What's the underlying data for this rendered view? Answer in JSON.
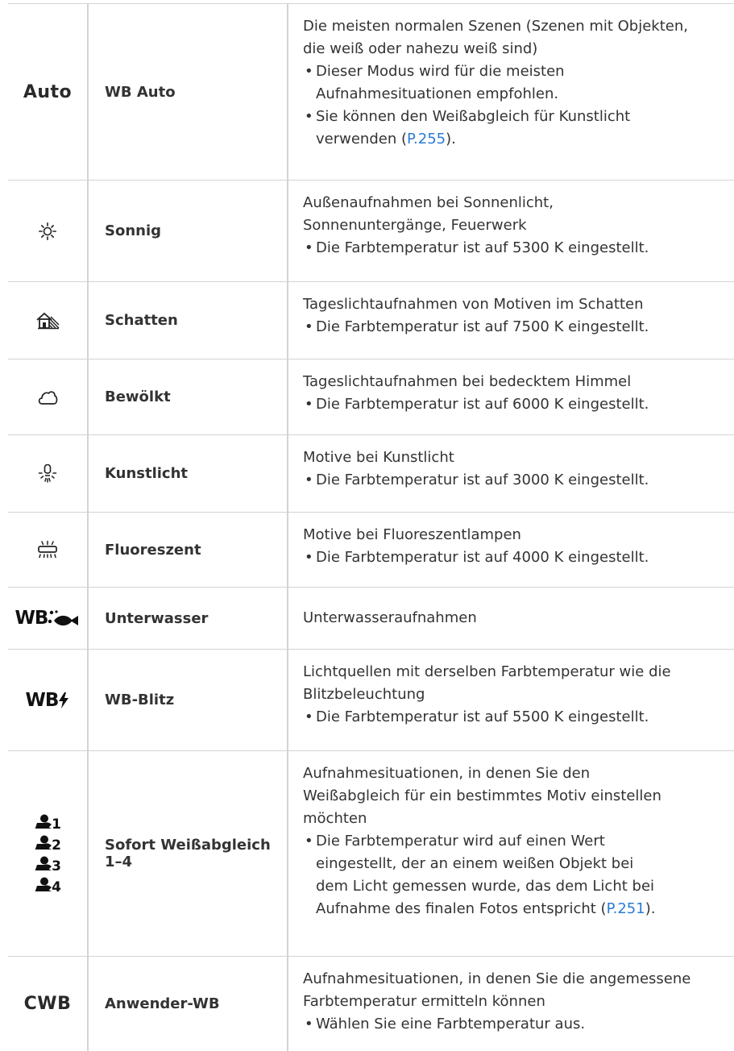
{
  "rows": [
    {
      "icon": "Auto",
      "name": "WB Auto",
      "desc": [
        "Die meisten normalen Szenen (Szenen mit Objekten,",
        "die weiß oder nahezu weiß sind)"
      ],
      "bullets": [
        [
          "Dieser Modus wird für die meisten",
          "Aufnahmesituationen empfohlen."
        ],
        [
          "Sie können den Weißabgleich für Kunstlicht"
        ]
      ],
      "bullet_tail": {
        "pre": "verwenden (",
        "link": "P.255",
        "post": ")."
      }
    },
    {
      "icon_name": "sun-icon",
      "name": "Sonnig",
      "desc": [
        "Außenaufnahmen bei Sonnenlicht,",
        "Sonnenuntergänge, Feuerwerk"
      ],
      "bullets": [
        [
          "Die Farbtemperatur ist auf 5300 K eingestellt."
        ]
      ]
    },
    {
      "icon_name": "shade-icon",
      "name": "Schatten",
      "desc": [
        "Tageslichtaufnahmen von Motiven im Schatten"
      ],
      "bullets": [
        [
          "Die Farbtemperatur ist auf 7500 K eingestellt."
        ]
      ]
    },
    {
      "icon_name": "cloud-icon",
      "name": "Bewölkt",
      "desc": [
        "Tageslichtaufnahmen bei bedecktem Himmel"
      ],
      "bullets": [
        [
          "Die Farbtemperatur ist auf 6000 K eingestellt."
        ]
      ]
    },
    {
      "icon_name": "bulb-icon",
      "name": "Kunstlicht",
      "desc": [
        "Motive bei Kunstlicht"
      ],
      "bullets": [
        [
          "Die Farbtemperatur ist auf 3000 K eingestellt."
        ]
      ]
    },
    {
      "icon_name": "fluorescent-icon",
      "name": "Fluoreszent",
      "desc": [
        "Motive bei Fluoreszentlampen"
      ],
      "bullets": [
        [
          "Die Farbtemperatur ist auf 4000 K eingestellt."
        ]
      ]
    },
    {
      "icon_name": "underwater-icon",
      "icon_wb": "WB",
      "name": "Unterwasser",
      "desc": [
        "Unterwasseraufnahmen"
      ],
      "bullets": []
    },
    {
      "icon_name": "flash-icon",
      "icon_wb": "WB",
      "name": "WB-Blitz",
      "desc": [
        "Lichtquellen mit derselben Farbtemperatur wie die",
        "Blitzbeleuchtung"
      ],
      "bullets": [
        [
          "Die Farbtemperatur ist auf 5500 K eingestellt."
        ]
      ]
    },
    {
      "icon_name": "one-touch-wb-icon",
      "pwb_nums": [
        "1",
        "2",
        "3",
        "4"
      ],
      "name": "Sofort Weißabgleich 1–4",
      "desc": [
        "Aufnahmesituationen, in denen Sie den",
        "Weißabgleich für ein bestimmtes Motiv einstellen",
        "möchten"
      ],
      "bullets": [
        [
          "Die Farbtemperatur wird auf einen Wert",
          "eingestellt, der an einem weißen Objekt bei",
          "dem Licht gemessen wurde, das dem Licht bei"
        ]
      ],
      "bullet_tail": {
        "pre": "Aufnahme des finalen Fotos entspricht (",
        "link": "P.251",
        "post": ")."
      }
    },
    {
      "icon": "CWB",
      "name": "Anwender-WB",
      "desc": [
        "Aufnahmesituationen, in denen Sie die angemessene",
        "Farbtemperatur ermitteln können"
      ],
      "bullets": [
        [
          "Wählen Sie eine Farbtemperatur aus."
        ]
      ]
    }
  ]
}
